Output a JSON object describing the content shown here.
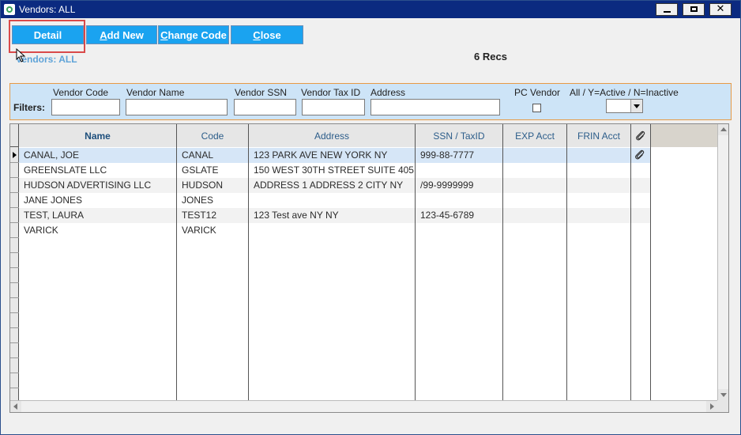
{
  "window": {
    "title": "Vendors: ALL",
    "minimize": "minimize",
    "maximize": "maximize",
    "close": "close"
  },
  "toolbar": {
    "detail_label": "Detail",
    "addnew_pre": "A",
    "addnew_rest": "dd New",
    "change_pre": "C",
    "change_rest": "hange Code",
    "close_pre": "C",
    "close_rest": "lose"
  },
  "context_label": "Vendors: ALL",
  "record_count": "6 Recs",
  "filters": {
    "label": "Filters:",
    "vendor_code_label": "Vendor Code",
    "vendor_name_label": "Vendor Name",
    "vendor_ssn_label": "Vendor SSN",
    "vendor_taxid_label": "Vendor Tax ID",
    "address_label": "Address",
    "pc_vendor_label": "PC Vendor",
    "status_label": "All / Y=Active / N=Inactive",
    "vendor_code_value": "",
    "vendor_name_value": "",
    "vendor_ssn_value": "",
    "vendor_taxid_value": "",
    "address_value": "",
    "pc_vendor_checked": false,
    "status_value": ""
  },
  "grid": {
    "columns": [
      "Name",
      "Code",
      "Address",
      "SSN / TaxID",
      "EXP Acct",
      "FRIN Acct",
      "attachment"
    ],
    "rows": [
      {
        "name": "CANAL, JOE",
        "code": "CANAL",
        "address": "123 PARK AVE   NEW YORK NY",
        "ssn": "999-88-7777",
        "exp": "",
        "frin": "",
        "attachment": true,
        "selected": true
      },
      {
        "name": "GREENSLATE LLC",
        "code": "GSLATE",
        "address": "150 WEST 30TH STREET SUITE 405",
        "ssn": "",
        "exp": "",
        "frin": "",
        "attachment": false,
        "selected": false
      },
      {
        "name": "HUDSON ADVERTISING LLC",
        "code": "HUDSON",
        "address": "ADDRESS 1 ADDRESS 2  CITY NY",
        "ssn": "/99-9999999",
        "exp": "",
        "frin": "",
        "attachment": false,
        "selected": false
      },
      {
        "name": "JANE JONES",
        "code": "JONES",
        "address": "",
        "ssn": "",
        "exp": "",
        "frin": "",
        "attachment": false,
        "selected": false
      },
      {
        "name": "TEST, LAURA",
        "code": "TEST12",
        "address": "123 Test ave   NY NY",
        "ssn": "123-45-6789",
        "exp": "",
        "frin": "",
        "attachment": false,
        "selected": false
      },
      {
        "name": "VARICK",
        "code": "VARICK",
        "address": "",
        "ssn": "",
        "exp": "",
        "frin": "",
        "attachment": false,
        "selected": false
      }
    ]
  },
  "icons": {
    "app": "app-logo-icon",
    "cursor": "mouse-pointer-icon",
    "attachment": "paperclip-icon",
    "row_pointer": "row-pointer-icon"
  },
  "colors": {
    "titlebar": "#0b2a80",
    "button": "#1aa3f0",
    "filters_bg": "#cde4f7",
    "filters_border": "#e89a45",
    "header_text": "#2c5d8a",
    "selected_row": "#d6e6f7"
  }
}
